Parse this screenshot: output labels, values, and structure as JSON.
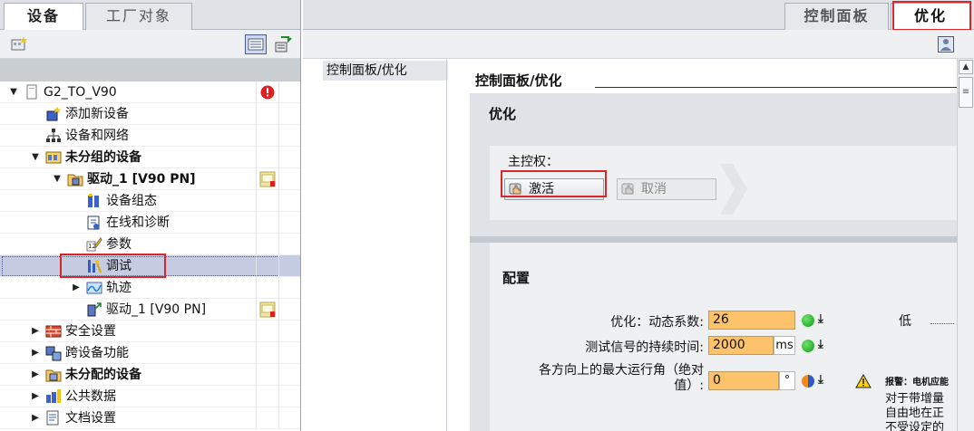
{
  "left": {
    "tabs": [
      "设备",
      "工厂对象"
    ],
    "tree": [
      {
        "label": "G2_TO_V90",
        "bold": false,
        "indent": 0,
        "arrow": "down",
        "icon": "project-icon",
        "status": "error-badge-icon"
      },
      {
        "label": "添加新设备",
        "bold": false,
        "indent": 1,
        "arrow": "",
        "icon": "add-device-icon",
        "status": ""
      },
      {
        "label": "设备和网络",
        "bold": false,
        "indent": 1,
        "arrow": "",
        "icon": "network-icon",
        "status": ""
      },
      {
        "label": "未分组的设备",
        "bold": true,
        "indent": 1,
        "arrow": "down",
        "icon": "ungrouped-devices-icon",
        "status": ""
      },
      {
        "label": "驱动_1 [V90 PN]",
        "bold": true,
        "indent": 2,
        "arrow": "down",
        "icon": "drive-folder-icon",
        "status": "warning-badge-icon"
      },
      {
        "label": "设备组态",
        "bold": false,
        "indent": 3,
        "arrow": "",
        "icon": "device-config-icon",
        "status": ""
      },
      {
        "label": "在线和诊断",
        "bold": false,
        "indent": 3,
        "arrow": "",
        "icon": "online-diag-icon",
        "status": ""
      },
      {
        "label": "参数",
        "bold": false,
        "indent": 3,
        "arrow": "",
        "icon": "parameters-icon",
        "status": ""
      },
      {
        "label": "调试",
        "bold": false,
        "indent": 3,
        "arrow": "",
        "icon": "commissioning-icon",
        "status": ""
      },
      {
        "label": "轨迹",
        "bold": false,
        "indent": 3,
        "arrow": "right",
        "icon": "trace-icon",
        "status": ""
      },
      {
        "label": "驱动_1 [V90 PN]",
        "bold": false,
        "indent": 3,
        "arrow": "",
        "icon": "drive-device-icon",
        "status": "warning-badge-icon"
      },
      {
        "label": "安全设置",
        "bold": false,
        "indent": 1,
        "arrow": "right",
        "icon": "security-icon",
        "status": ""
      },
      {
        "label": "跨设备功能",
        "bold": false,
        "indent": 1,
        "arrow": "right",
        "icon": "cross-device-icon",
        "status": ""
      },
      {
        "label": "未分配的设备",
        "bold": true,
        "indent": 1,
        "arrow": "right",
        "icon": "unassigned-devices-icon",
        "status": ""
      },
      {
        "label": "公共数据",
        "bold": false,
        "indent": 1,
        "arrow": "right",
        "icon": "common-data-icon",
        "status": ""
      },
      {
        "label": "文档设置",
        "bold": false,
        "indent": 1,
        "arrow": "right",
        "icon": "doc-settings-icon",
        "status": ""
      }
    ]
  },
  "right": {
    "tabs": [
      "控制面板",
      "优化"
    ],
    "nav_item": "控制面板/优化",
    "content_title": "控制面板/优化",
    "section_opt": {
      "title": "优化",
      "master_label": "主控权：",
      "activate_label": "激活",
      "cancel_label": "取消"
    },
    "section_cfg": {
      "title": "配置",
      "params": [
        {
          "label": "优化：动态系数:",
          "value": "26",
          "unit": ""
        },
        {
          "label": "测试信号的持续时间:",
          "value": "2000",
          "unit": "ms"
        },
        {
          "label1": "各方向上的最大运行角（绝对",
          "label2": "值）:",
          "value": "0",
          "unit": "°"
        }
      ],
      "low_label": "低",
      "warning_title": "报警：电机应能",
      "warning_lines": [
        "对于带增量",
        "自由地在正",
        "不受设定的"
      ]
    }
  },
  "colors": {
    "highlight": "#d9262b",
    "field": "#fdc36a",
    "selection": "#c5cbe1"
  }
}
